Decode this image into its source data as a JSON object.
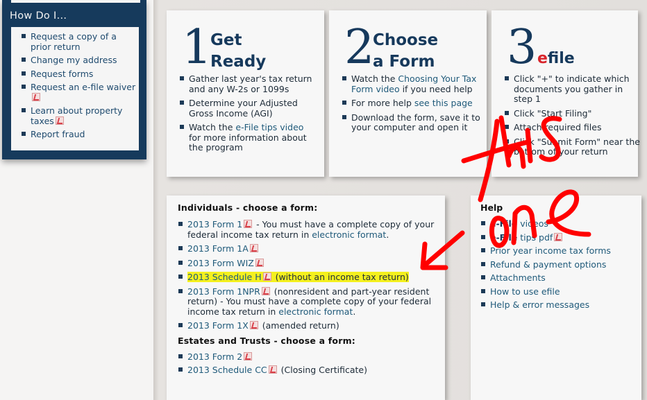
{
  "sidebar": {
    "title": "How Do I...",
    "items": [
      {
        "label": "Request a copy of a prior return",
        "pdf": false
      },
      {
        "label": "Change my address",
        "pdf": false
      },
      {
        "label": "Request forms",
        "pdf": false
      },
      {
        "label": "Request an e-file waiver",
        "pdf": true
      },
      {
        "label": "Learn about property taxes",
        "pdf": true
      },
      {
        "label": "Report fraud",
        "pdf": false
      }
    ]
  },
  "steps": [
    {
      "number": "1",
      "title_line1": "Get",
      "title_line2": "Ready",
      "bullets": [
        {
          "pre": "Gather last year's tax return and any W-2s or 1099s",
          "link": "",
          "post": ""
        },
        {
          "pre": "Determine your Adjusted Gross Income (AGI)",
          "link": "",
          "post": ""
        },
        {
          "pre": "Watch the ",
          "link": "e-File tips video",
          "post": " for more information about the program"
        }
      ]
    },
    {
      "number": "2",
      "title_line1": "Choose",
      "title_line2": "a Form",
      "bullets": [
        {
          "pre": "Watch the ",
          "link": "Choosing Your Tax Form video",
          "post": " if you need help"
        },
        {
          "pre": "For more help ",
          "link": "see this page",
          "post": ""
        },
        {
          "pre": "Download the form, save it to your computer and open it",
          "link": "",
          "post": ""
        }
      ]
    },
    {
      "number": "3",
      "title_e": "e",
      "title_rest": "file",
      "bullets": [
        {
          "pre": "Click \"+\" to indicate which documents you gather in step 1",
          "link": "",
          "post": ""
        },
        {
          "pre": "Click \"Start Filing\"",
          "link": "",
          "post": ""
        },
        {
          "pre": "Attach required files",
          "link": "",
          "post": ""
        },
        {
          "pre": "Click \"Submit Form\" near the bottom of your return",
          "link": "",
          "post": ""
        }
      ]
    }
  ],
  "forms": {
    "individuals_heading": "Individuals - choose a form:",
    "individuals": [
      {
        "link": "2013 Form 1",
        "pdf": true,
        "pre_note": " - You must have a complete copy of your federal income tax return in ",
        "note_link": "electronic format",
        "post_note": ".",
        "highlight": false
      },
      {
        "link": "2013 Form 1A",
        "pdf": true,
        "pre_note": "",
        "note_link": "",
        "post_note": "",
        "highlight": false
      },
      {
        "link": "2013 Form WIZ",
        "pdf": true,
        "pre_note": "",
        "note_link": "",
        "post_note": "",
        "highlight": false
      },
      {
        "link": "2013 Schedule H",
        "pdf": true,
        "pre_note": " (without an income tax return)",
        "note_link": "",
        "post_note": "",
        "highlight": true
      },
      {
        "link": "2013 Form 1NPR",
        "pdf": true,
        "pre_note": " (nonresident and part-year resident return) - You must have a complete copy of your federal income tax return in ",
        "note_link": "electronic format",
        "post_note": ".",
        "highlight": false
      },
      {
        "link": "2013 Form 1X",
        "pdf": true,
        "pre_note": " (amended return)",
        "note_link": "",
        "post_note": "",
        "highlight": false
      }
    ],
    "estates_heading": "Estates and Trusts - choose a form:",
    "estates": [
      {
        "link": "2013 Form 2",
        "pdf": true,
        "pre_note": "",
        "note_link": "",
        "post_note": "",
        "highlight": false
      },
      {
        "link": "2013 Schedule CC",
        "pdf": true,
        "pre_note": " (Closing Certificate)",
        "note_link": "",
        "post_note": "",
        "highlight": false
      }
    ]
  },
  "help": {
    "heading": "Help",
    "items": [
      {
        "bold": "e-File",
        "label": " videos",
        "pdf": false
      },
      {
        "bold": "e-File",
        "label": " tips pdf",
        "pdf": true
      },
      {
        "bold": "",
        "label": "Prior year income tax forms",
        "pdf": false
      },
      {
        "bold": "",
        "label": "Refund & payment options",
        "pdf": false
      },
      {
        "bold": "",
        "label": "Attachments",
        "pdf": false
      },
      {
        "bold": "",
        "label": "How to use efile",
        "pdf": false
      },
      {
        "bold": "",
        "label": "Help & error messages",
        "pdf": false
      }
    ]
  },
  "annotation": {
    "handwritten_text": "this one",
    "color": "#ff0000",
    "points_to": "2013 Schedule H"
  },
  "colors": {
    "navy": "#16395c",
    "link": "#1f5a7a",
    "efile_red": "#d8252c",
    "highlight": "#f4f01e"
  }
}
